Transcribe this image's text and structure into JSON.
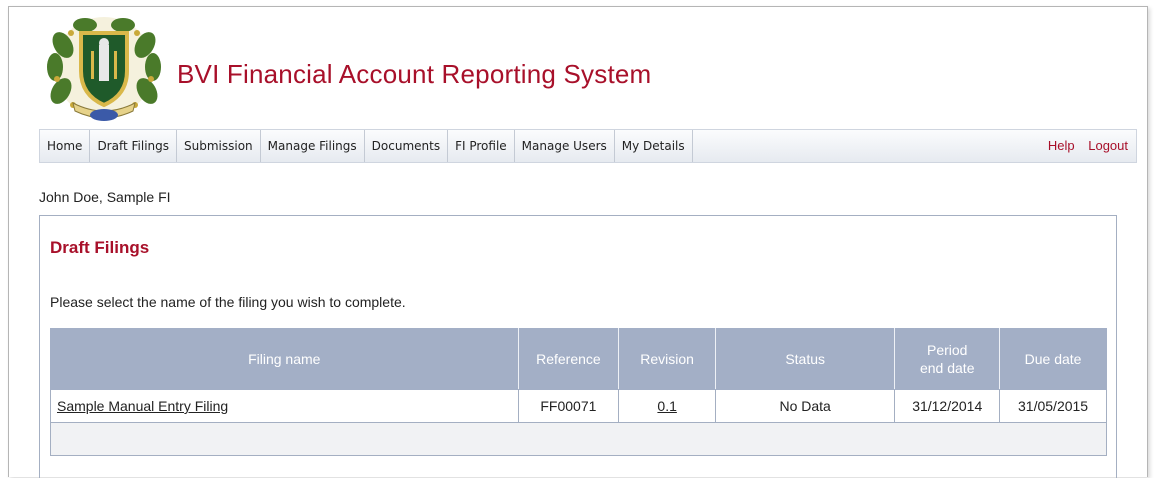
{
  "header": {
    "title": "BVI Financial Account Reporting System",
    "crest_icon": "bvi-coat-of-arms-logo"
  },
  "nav": {
    "items": [
      "Home",
      "Draft Filings",
      "Submission",
      "Manage Filings",
      "Documents",
      "FI Profile",
      "Manage Users",
      "My Details"
    ],
    "help": "Help",
    "logout": "Logout"
  },
  "user": {
    "display": "John Doe, Sample FI"
  },
  "panel": {
    "title": "Draft Filings",
    "instructions": "Please select the name of the filing you wish to complete."
  },
  "table": {
    "headers": {
      "filing_name": "Filing name",
      "reference": "Reference",
      "revision": "Revision",
      "status": "Status",
      "period_line1": "Period",
      "period_line2": "end date",
      "due_date": "Due date"
    },
    "rows": [
      {
        "filing_name": "Sample Manual Entry Filing",
        "reference": "FF00071",
        "revision": "0.1",
        "status": "No Data",
        "period_end": "31/12/2014",
        "due_date": "31/05/2015"
      }
    ]
  },
  "colors": {
    "brand_red": "#a8102a",
    "table_header": "#a3afc6",
    "border": "#a4afc2"
  }
}
